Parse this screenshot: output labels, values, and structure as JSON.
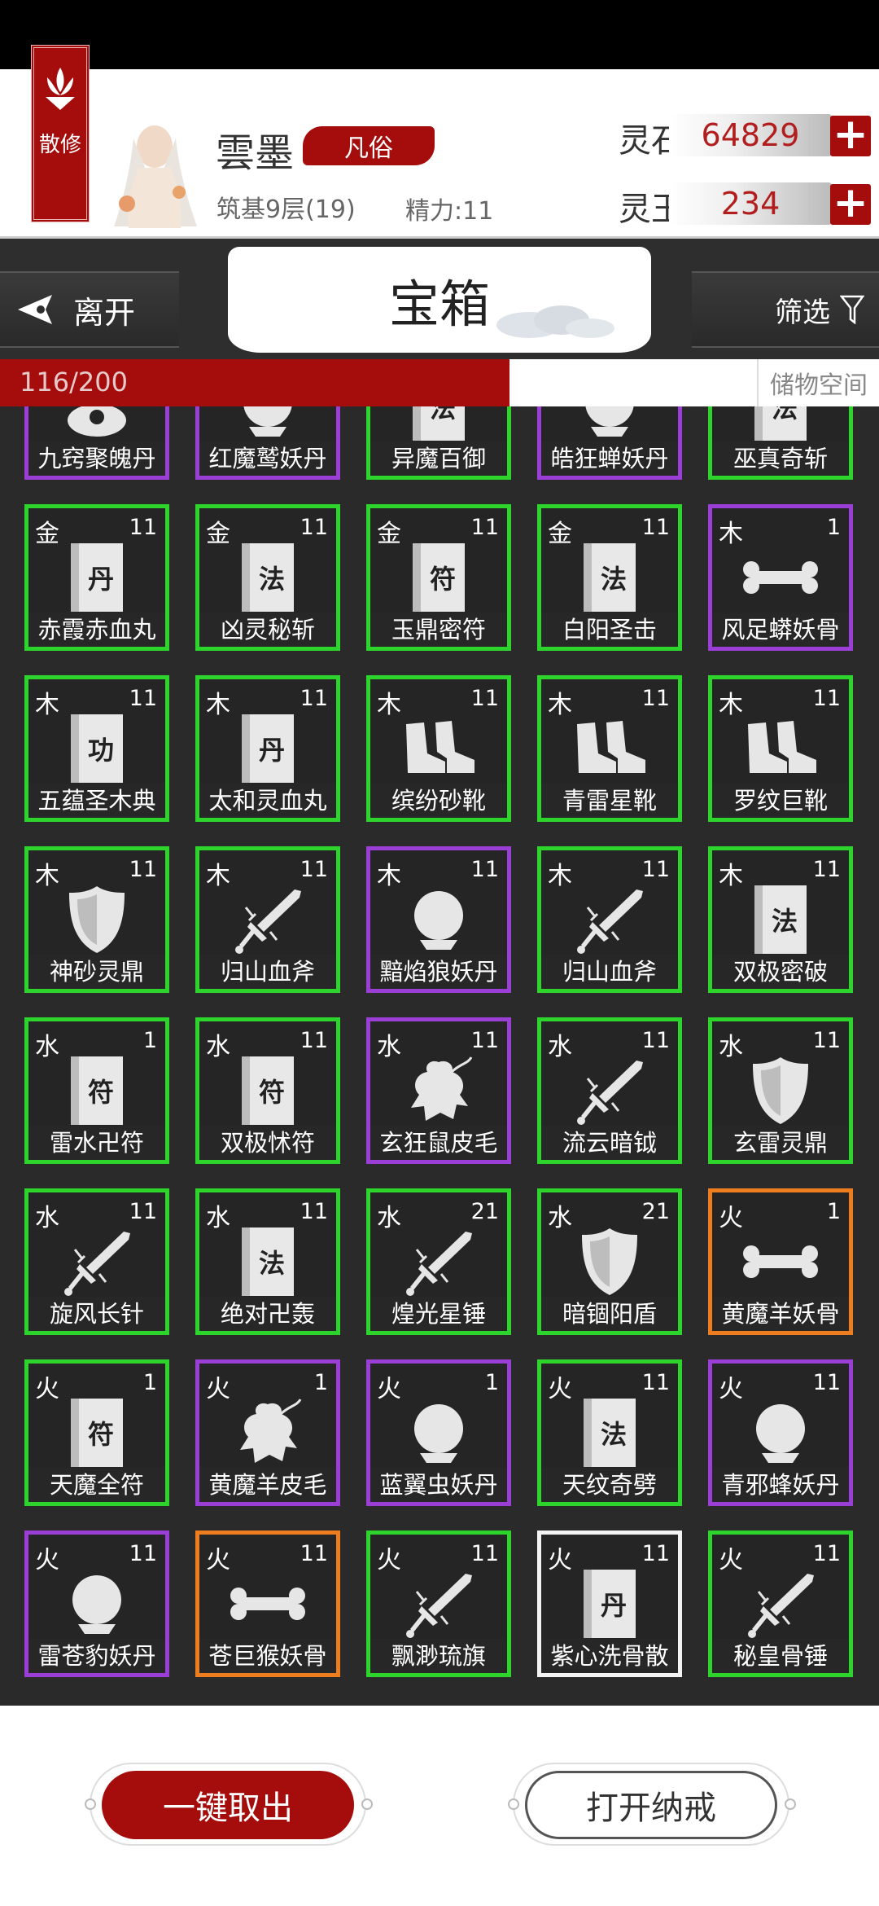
{
  "header": {
    "sect_label": "散修",
    "player_name": "雲墨",
    "rank": "凡俗",
    "realm": "筑基9层(19)",
    "energy": "精力:11",
    "currencies": [
      {
        "label": "灵石",
        "value": "64829"
      },
      {
        "label": "灵玉",
        "value": "234"
      }
    ]
  },
  "nav": {
    "leave_label": "离开",
    "title": "宝箱",
    "filter_label": "筛选"
  },
  "capacity": {
    "text": "116/200",
    "used": 116,
    "total": 200,
    "storage_label": "储物空间"
  },
  "items": [
    {
      "elem": "",
      "count": "",
      "name": "九窍聚魄丹",
      "rarity": "purple",
      "icon": "swirl-icon"
    },
    {
      "elem": "",
      "count": "",
      "name": "红魔鹫妖丹",
      "rarity": "purple",
      "icon": "orb-icon"
    },
    {
      "elem": "",
      "count": "",
      "name": "异魔百御",
      "rarity": "green",
      "icon": "book-icon",
      "book_char": "法"
    },
    {
      "elem": "",
      "count": "",
      "name": "皓狂蝉妖丹",
      "rarity": "purple",
      "icon": "orb-icon"
    },
    {
      "elem": "",
      "count": "",
      "name": "巫真奇斩",
      "rarity": "green",
      "icon": "book-icon",
      "book_char": "法"
    },
    {
      "elem": "金",
      "count": "11",
      "name": "赤霞赤血丸",
      "rarity": "green",
      "icon": "book-icon",
      "book_char": "丹"
    },
    {
      "elem": "金",
      "count": "11",
      "name": "凶灵秘斩",
      "rarity": "green",
      "icon": "book-icon",
      "book_char": "法"
    },
    {
      "elem": "金",
      "count": "11",
      "name": "玉鼎密符",
      "rarity": "green",
      "icon": "book-icon",
      "book_char": "符"
    },
    {
      "elem": "金",
      "count": "11",
      "name": "白阳圣击",
      "rarity": "green",
      "icon": "book-icon",
      "book_char": "法"
    },
    {
      "elem": "木",
      "count": "1",
      "name": "风足蟒妖骨",
      "rarity": "purple",
      "icon": "bone-icon"
    },
    {
      "elem": "木",
      "count": "11",
      "name": "五蕴圣木典",
      "rarity": "green",
      "icon": "book-icon",
      "book_char": "功"
    },
    {
      "elem": "木",
      "count": "11",
      "name": "太和灵血丸",
      "rarity": "green",
      "icon": "book-icon",
      "book_char": "丹"
    },
    {
      "elem": "木",
      "count": "11",
      "name": "缤纷砂靴",
      "rarity": "green",
      "icon": "boots-icon"
    },
    {
      "elem": "木",
      "count": "11",
      "name": "青雷星靴",
      "rarity": "green",
      "icon": "boots-icon"
    },
    {
      "elem": "木",
      "count": "11",
      "name": "罗纹巨靴",
      "rarity": "green",
      "icon": "boots-icon"
    },
    {
      "elem": "木",
      "count": "11",
      "name": "神砂灵鼎",
      "rarity": "green",
      "icon": "shield-icon"
    },
    {
      "elem": "木",
      "count": "11",
      "name": "归山血斧",
      "rarity": "green",
      "icon": "sword-icon"
    },
    {
      "elem": "木",
      "count": "11",
      "name": "黯焰狼妖丹",
      "rarity": "purple",
      "icon": "orb-icon"
    },
    {
      "elem": "木",
      "count": "11",
      "name": "归山血斧",
      "rarity": "green",
      "icon": "sword-icon"
    },
    {
      "elem": "木",
      "count": "11",
      "name": "双极密破",
      "rarity": "green",
      "icon": "book-icon",
      "book_char": "法"
    },
    {
      "elem": "水",
      "count": "1",
      "name": "雷水卍符",
      "rarity": "green",
      "icon": "book-icon",
      "book_char": "符"
    },
    {
      "elem": "水",
      "count": "11",
      "name": "双极怵符",
      "rarity": "green",
      "icon": "book-icon",
      "book_char": "符"
    },
    {
      "elem": "水",
      "count": "11",
      "name": "玄狂鼠皮毛",
      "rarity": "purple",
      "icon": "pelt-icon"
    },
    {
      "elem": "水",
      "count": "11",
      "name": "流云暗钺",
      "rarity": "green",
      "icon": "sword-icon"
    },
    {
      "elem": "水",
      "count": "11",
      "name": "玄雷灵鼎",
      "rarity": "green",
      "icon": "shield-icon"
    },
    {
      "elem": "水",
      "count": "11",
      "name": "旋风长针",
      "rarity": "green",
      "icon": "sword-icon"
    },
    {
      "elem": "水",
      "count": "11",
      "name": "绝对卍轰",
      "rarity": "green",
      "icon": "book-icon",
      "book_char": "法"
    },
    {
      "elem": "水",
      "count": "21",
      "name": "煌光星锤",
      "rarity": "green",
      "icon": "sword-icon"
    },
    {
      "elem": "水",
      "count": "21",
      "name": "暗锢阳盾",
      "rarity": "green",
      "icon": "shield-icon"
    },
    {
      "elem": "火",
      "count": "1",
      "name": "黄魔羊妖骨",
      "rarity": "orange",
      "icon": "bone-icon"
    },
    {
      "elem": "火",
      "count": "1",
      "name": "天魔全符",
      "rarity": "green",
      "icon": "book-icon",
      "book_char": "符"
    },
    {
      "elem": "火",
      "count": "1",
      "name": "黄魔羊皮毛",
      "rarity": "purple",
      "icon": "pelt-icon"
    },
    {
      "elem": "火",
      "count": "1",
      "name": "蓝翼虫妖丹",
      "rarity": "purple",
      "icon": "orb-icon"
    },
    {
      "elem": "火",
      "count": "11",
      "name": "天纹奇劈",
      "rarity": "green",
      "icon": "book-icon",
      "book_char": "法"
    },
    {
      "elem": "火",
      "count": "11",
      "name": "青邪蜂妖丹",
      "rarity": "purple",
      "icon": "orb-icon"
    },
    {
      "elem": "火",
      "count": "11",
      "name": "雷苍豹妖丹",
      "rarity": "purple",
      "icon": "orb-icon"
    },
    {
      "elem": "火",
      "count": "11",
      "name": "苍巨猴妖骨",
      "rarity": "orange",
      "icon": "bone-icon"
    },
    {
      "elem": "火",
      "count": "11",
      "name": "飘渺琉旗",
      "rarity": "green",
      "icon": "sword-icon"
    },
    {
      "elem": "火",
      "count": "11",
      "name": "紫心洗骨散",
      "rarity": "white",
      "icon": "book-icon",
      "book_char": "丹"
    },
    {
      "elem": "火",
      "count": "11",
      "name": "秘皇骨锤",
      "rarity": "green",
      "icon": "sword-icon"
    }
  ],
  "actions": {
    "take_all_label": "一键取出",
    "open_ring_label": "打开纳戒"
  },
  "colors": {
    "accent_red": "#a50d0d",
    "rarity_green": "#2cd42c",
    "rarity_purple": "#9a3ed6",
    "rarity_orange": "#ed7d1f",
    "rarity_white": "#f3f3f3"
  }
}
